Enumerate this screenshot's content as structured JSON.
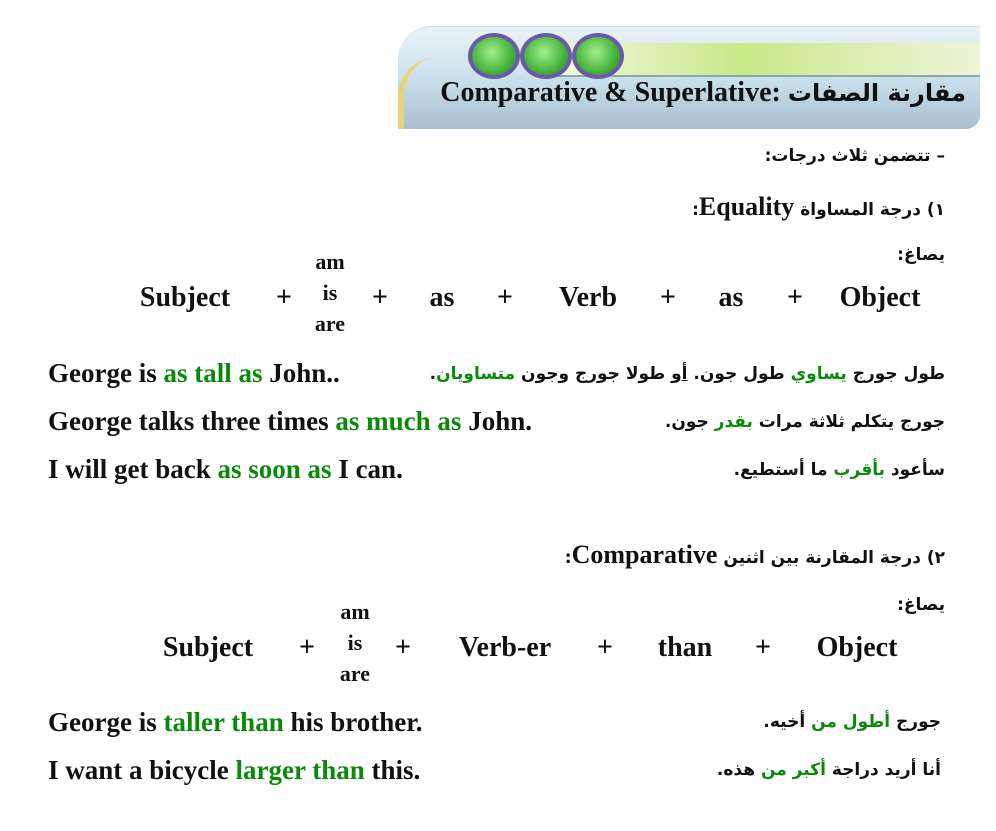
{
  "header": {
    "title_ar": "مقارنة الصفات",
    "title_en": "Comparative & Superlative:"
  },
  "intro": "– تتضمن ثلاث درجات:",
  "sections": [
    {
      "heading_ar": "١) درجة المساواة",
      "heading_en": "Equality",
      "heading_colon": ":",
      "formula_label": "يصاغ:",
      "formula": [
        "Subject",
        "+",
        "am",
        "is",
        "are",
        "+",
        "as",
        "+",
        "Verb",
        "+",
        "as",
        "+",
        "Object"
      ],
      "examples": [
        {
          "en": [
            "George is ",
            "as tall as",
            " John.."
          ],
          "ar": [
            "طول جورج ",
            "يساوي",
            " طول جون. ",
            "أو",
            " طولا جورج وجون ",
            "متساويان",
            "."
          ]
        },
        {
          "en": [
            "George talks three times ",
            "as much as",
            " John."
          ],
          "ar": [
            "جورج يتكلم ثلاثة مرات ",
            "بقدر",
            " جون."
          ]
        },
        {
          "en": [
            "I will get back ",
            "as soon as",
            " I can."
          ],
          "ar": [
            "سأعود ",
            "بأقرب",
            " ما أستطيع."
          ]
        }
      ]
    },
    {
      "heading_ar": "٢) درجة المقارنة بين اثنين",
      "heading_en": "Comparative",
      "heading_colon": ":",
      "formula_label": "يصاغ:",
      "formula": [
        "Subject",
        "+",
        "am",
        "is",
        "are",
        "+",
        "Verb-er",
        "+",
        "than",
        "+",
        "Object"
      ],
      "examples": [
        {
          "en": [
            "George is ",
            "taller than",
            " his brother."
          ],
          "ar": [
            "جورج ",
            "أطول من",
            " أخيه."
          ]
        },
        {
          "en": [
            "I want a bicycle ",
            "larger than",
            " this."
          ],
          "ar": [
            "أنا أريد دراجة ",
            "أكبر من",
            " هذه."
          ]
        }
      ]
    }
  ],
  "colors": {
    "highlight": "#0a8a0a",
    "text": "#111111"
  }
}
